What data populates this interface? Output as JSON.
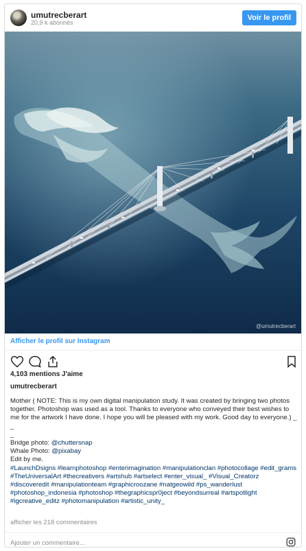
{
  "header": {
    "username": "umutrecberart",
    "followers": "20,9 k abonnés",
    "profile_button": "Voir le profil"
  },
  "photo": {
    "alt": "",
    "watermark": "@umutrecberart"
  },
  "view_profile_link": "Afficher le profil sur Instagram",
  "likes": "4,103 mentions J'aime",
  "caption": {
    "username": "umutrecberart",
    "body": "Mother ( NOTE: This is my own digital manipulation study. It was created by bringing two photos together. Photoshop was used as a tool. Thanks to everyone who conveyed their best wishes to me for the artwork I have done. I hope you will be pleased with my work. Good day to everyone.) _",
    "line_dash1": "_",
    "line_dash2": "_",
    "bridge_label": "Bridge photo: ",
    "bridge_mention": "@chuttersnap",
    "whale_label": "Whale Photo: ",
    "whale_mention": "@pixabay",
    "edit": "Edit by me.",
    "hashtags": "#LaunchDsigns #learnphotoshop #enterimagination #manipulationclan #photocollage #edit_grams #TheUniversalArt #thecreativers #artshub #artselect #enter_visual_ #Visual_Creatorz #discoveredit #manipulationteam #graphicroozane #natgeowild #ps_wanderlust #photoshop_indonesia #photoshop #thegraphicspr0ject #beyondsurreal #artspotlight #igcreative_editz #photomanipulation #artistic_unity_"
  },
  "comments_link": "afficher les 218 commentaires",
  "comment_placeholder": "Ajouter un commentaire...",
  "icons": {
    "like": "heart-icon",
    "comment": "comment-icon",
    "share": "share-icon",
    "save": "bookmark-icon",
    "instagram": "instagram-icon"
  },
  "colors": {
    "accent": "#3897f0",
    "link": "#003569",
    "muted": "#8e8e8e",
    "text": "#262626"
  }
}
